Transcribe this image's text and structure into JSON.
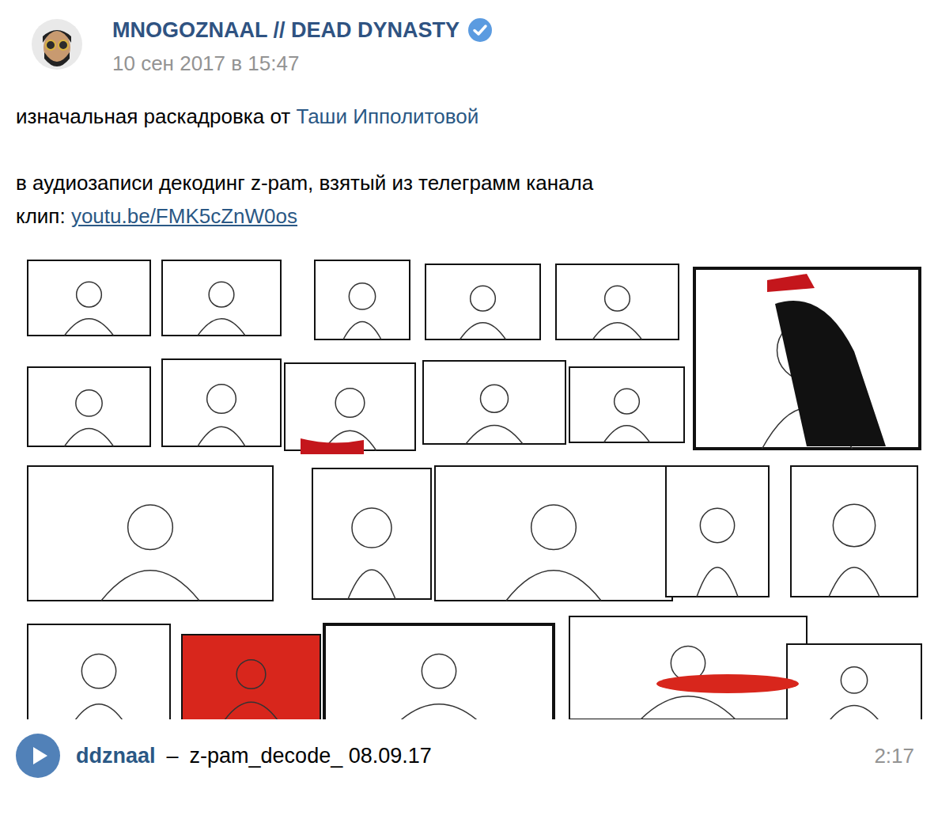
{
  "post": {
    "author": "MNOGOZNAAL // DEAD DYNASTY",
    "verified": true,
    "date": "10 сен 2017 в 15:47"
  },
  "body": [
    {
      "parts": [
        {
          "text": "изначальная раскадровка от ",
          "kind": "plain"
        },
        {
          "text": "Таши Ипполитовой",
          "kind": "mention"
        }
      ]
    },
    {
      "parts": [
        {
          "text": "в аудиозаписи декодинг z-pam, взятый из телеграмм канала",
          "kind": "plain"
        }
      ]
    },
    {
      "parts": [
        {
          "text": "клип: ",
          "kind": "plain"
        },
        {
          "text": "youtu.be/FMK5cZnW0os",
          "kind": "url"
        }
      ]
    }
  ],
  "audio": {
    "artist": "ddznaal",
    "separator": "–",
    "title": "z-pam_decode_ 08.09.17",
    "duration": "2:17"
  }
}
